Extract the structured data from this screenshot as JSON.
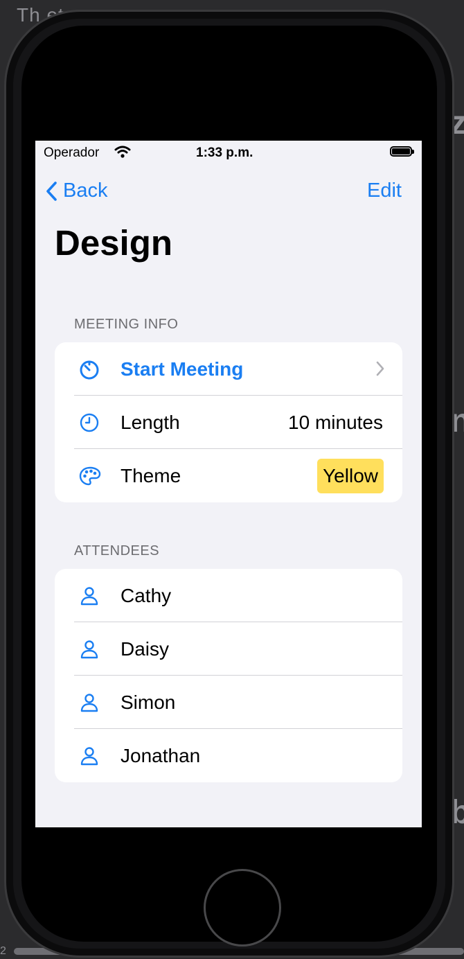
{
  "background": {
    "top_text": "Th                                         et.",
    "right_glyphs": [
      "z",
      "n",
      "b"
    ],
    "footer_number": "2"
  },
  "status_bar": {
    "carrier": "Operador",
    "time": "1:33 p.m."
  },
  "nav": {
    "back_label": "Back",
    "edit_label": "Edit"
  },
  "title": "Design",
  "meeting_info": {
    "header": "MEETING INFO",
    "start_meeting": {
      "label": "Start Meeting",
      "icon": "timer-icon"
    },
    "length": {
      "label": "Length",
      "value": "10 minutes",
      "icon": "clock-icon"
    },
    "theme": {
      "label": "Theme",
      "value": "Yellow",
      "icon": "palette-icon",
      "color": "#ffdf5c"
    }
  },
  "attendees": {
    "header": "ATTENDEES",
    "items": [
      {
        "name": "Cathy",
        "icon": "person-icon"
      },
      {
        "name": "Daisy",
        "icon": "person-icon"
      },
      {
        "name": "Simon",
        "icon": "person-icon"
      },
      {
        "name": "Jonathan",
        "icon": "person-icon"
      }
    ]
  },
  "colors": {
    "accent": "#1a7ef2",
    "background": "#f2f2f7",
    "separator": "#d1d1d6"
  }
}
